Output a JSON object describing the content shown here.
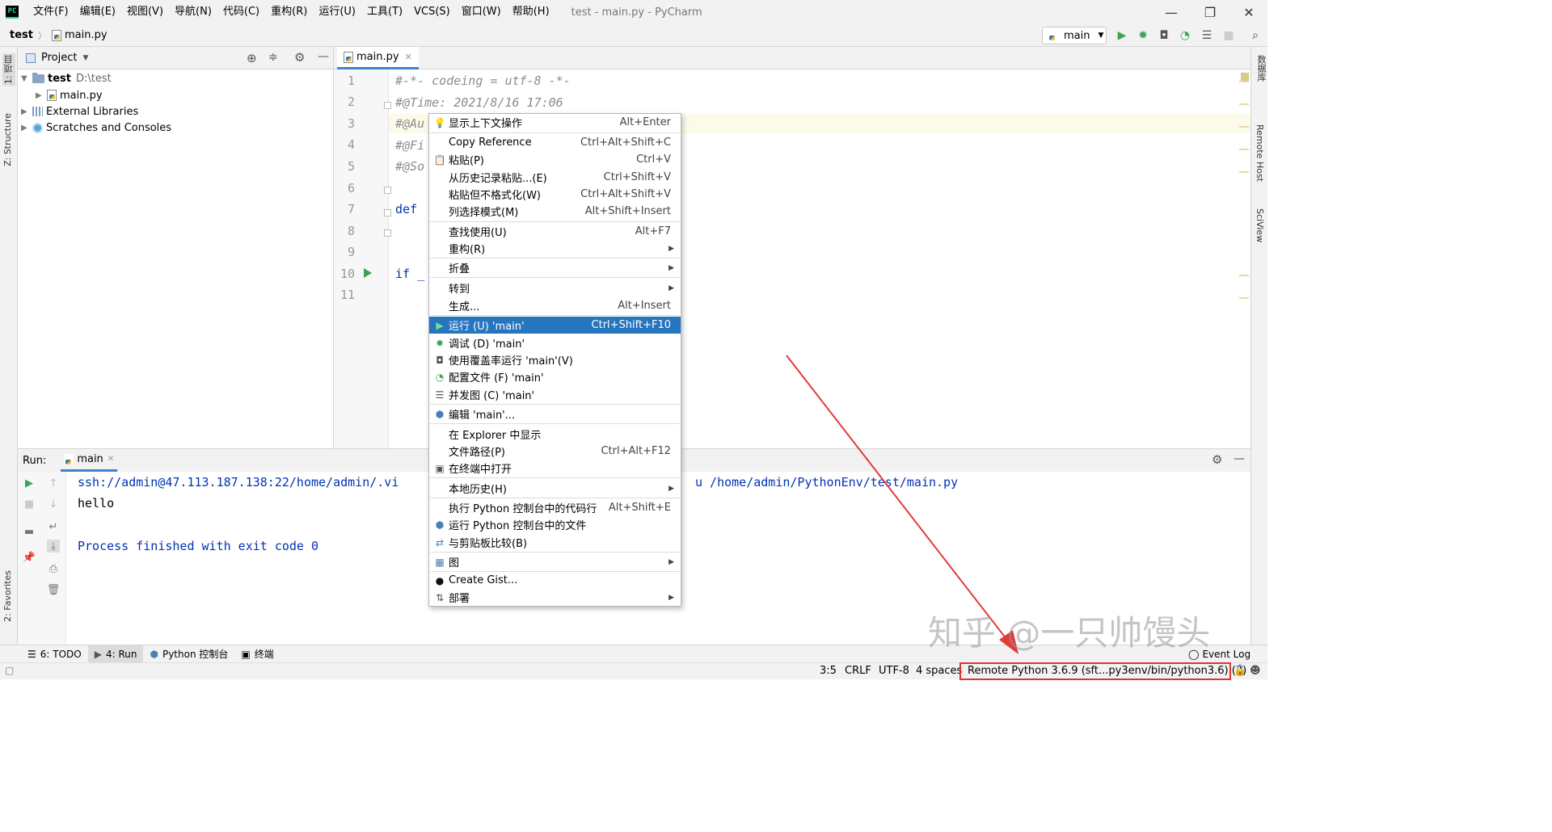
{
  "app": {
    "logo": "PC",
    "title": "test - main.py - PyCharm"
  },
  "menubar": [
    "文件(F)",
    "编辑(E)",
    "视图(V)",
    "导航(N)",
    "代码(C)",
    "重构(R)",
    "运行(U)",
    "工具(T)",
    "VCS(S)",
    "窗口(W)",
    "帮助(H)"
  ],
  "window_controls": {
    "minimize": "—",
    "maximize": "❐",
    "close": "✕"
  },
  "breadcrumb": {
    "project": "test",
    "file": "main.py"
  },
  "toolbar": {
    "run_config": "main"
  },
  "left_strip": {
    "project_tab": "1: 项目",
    "structure_tab": "Z: Structure",
    "favorites_tab": "2: Favorites"
  },
  "right_strip": {
    "db_tab": "数据库",
    "remote_tab": "Remote Host",
    "sciview_tab": "SciView"
  },
  "project_panel": {
    "title": "Project",
    "tree": [
      {
        "label": "test",
        "path": "D:\\test"
      },
      {
        "label": "main.py"
      },
      {
        "label": "External Libraries"
      },
      {
        "label": "Scratches and Consoles"
      }
    ]
  },
  "editor": {
    "tab": "main.py",
    "line_numbers": [
      "1",
      "2",
      "3",
      "4",
      "5",
      "6",
      "7",
      "8",
      "9",
      "10",
      "11"
    ],
    "lines": [
      "#-*- codeing = utf-8 -*-",
      "#@Time: 2021/8/16 17:06",
      "#@Au",
      "#@Fi",
      "#@So",
      "",
      "def ",
      "",
      "",
      "if _",
      ""
    ]
  },
  "run_panel": {
    "label": "Run:",
    "tab": "main",
    "console": [
      "ssh://admin@47.113.187.138:22/home/admin/.vi",
      "u /home/admin/PythonEnv/test/main.py",
      "hello",
      "Process finished with exit code 0"
    ]
  },
  "context_menu": {
    "items": [
      {
        "label": "显示上下文操作",
        "shortcut": "Alt+Enter"
      },
      {
        "label": "Copy Reference",
        "shortcut": "Ctrl+Alt+Shift+C"
      },
      {
        "label": "粘贴(P)",
        "shortcut": "Ctrl+V"
      },
      {
        "label": "从历史记录粘贴...(E)",
        "shortcut": "Ctrl+Shift+V"
      },
      {
        "label": "粘贴但不格式化(W)",
        "shortcut": "Ctrl+Alt+Shift+V"
      },
      {
        "label": "列选择模式(M)",
        "shortcut": "Alt+Shift+Insert"
      },
      {
        "label": "查找使用(U)",
        "shortcut": "Alt+F7"
      },
      {
        "label": "重构(R)",
        "shortcut": ""
      },
      {
        "label": "折叠",
        "shortcut": ""
      },
      {
        "label": "转到",
        "shortcut": ""
      },
      {
        "label": "生成...",
        "shortcut": "Alt+Insert"
      },
      {
        "label": "运行 (U) 'main'",
        "shortcut": "Ctrl+Shift+F10"
      },
      {
        "label": "调试 (D) 'main'",
        "shortcut": ""
      },
      {
        "label": "使用覆盖率运行 'main'(V)",
        "shortcut": ""
      },
      {
        "label": "配置文件 (F) 'main'",
        "shortcut": ""
      },
      {
        "label": "并发图 (C) 'main'",
        "shortcut": ""
      },
      {
        "label": "编辑 'main'...",
        "shortcut": ""
      },
      {
        "label": "在 Explorer 中显示",
        "shortcut": ""
      },
      {
        "label": "文件路径(P)",
        "shortcut": "Ctrl+Alt+F12"
      },
      {
        "label": "在终端中打开",
        "shortcut": ""
      },
      {
        "label": "本地历史(H)",
        "shortcut": ""
      },
      {
        "label": "执行 Python 控制台中的代码行",
        "shortcut": "Alt+Shift+E"
      },
      {
        "label": "运行 Python 控制台中的文件",
        "shortcut": ""
      },
      {
        "label": "与剪贴板比较(B)",
        "shortcut": ""
      },
      {
        "label": "图",
        "shortcut": ""
      },
      {
        "label": "Create Gist...",
        "shortcut": ""
      },
      {
        "label": "部署",
        "shortcut": ""
      }
    ]
  },
  "bottom_tabs": [
    "6: TODO",
    "4: Run",
    "Python 控制台",
    "终端"
  ],
  "event_log": "Event Log",
  "status": {
    "position": "3:5",
    "line_sep": "CRLF",
    "encoding": "UTF-8",
    "indent": "4 spaces",
    "interpreter": "Remote Python 3.6.9 (sft...py3env/bin/python3.6) (2)"
  },
  "watermark": "知乎 @一只帅馒头",
  "colors": {
    "accent": "#2675bf",
    "run_green": "#3aa655",
    "keyword": "#0033b3",
    "highlight_box": "#dd3333"
  }
}
